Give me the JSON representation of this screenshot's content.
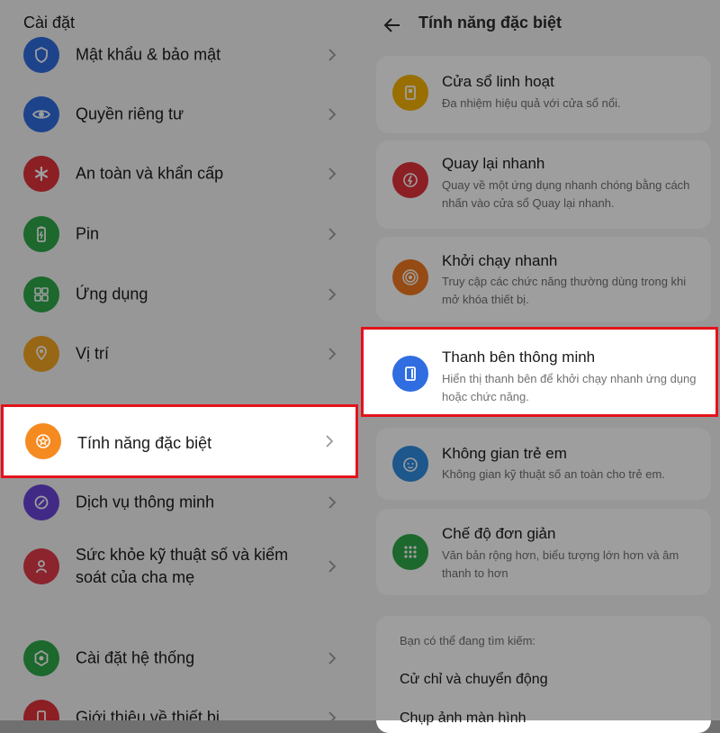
{
  "left": {
    "header": "Cài đặt",
    "items": [
      {
        "label": "Mật khẩu & bảo mật",
        "color": "#2f6de0",
        "icon": "shield-icon"
      },
      {
        "label": "Quyền riêng tư",
        "color": "#2f6de0",
        "icon": "privacy-eye-icon"
      },
      {
        "label": "An toàn và khẩn cấp",
        "color": "#e0323a",
        "icon": "emergency-asterisk-icon"
      },
      {
        "label": "Pin",
        "color": "#2ea94a",
        "icon": "battery-icon"
      },
      {
        "label": "Ứng dụng",
        "color": "#2ea94a",
        "icon": "apps-grid-icon"
      },
      {
        "label": "Vị trí",
        "color": "#f5a623",
        "icon": "location-pin-icon"
      },
      {
        "label": "Tính năng đặc biệt",
        "color": "#f58a20",
        "icon": "special-features-star-icon"
      },
      {
        "label": "Dịch vụ thông minh",
        "color": "#6a45d8",
        "icon": "smart-services-icon"
      },
      {
        "label": "Sức khỏe kỹ thuật số và kiểm soát của cha mẹ",
        "line1": "Sức khỏe kỹ thuật số và kiểm",
        "line2": "soát của cha mẹ",
        "color": "#e03a4a",
        "icon": "digital-wellbeing-icon"
      },
      {
        "label": "Cài đặt hệ thống",
        "color": "#2ea94a",
        "icon": "system-settings-gear-icon"
      },
      {
        "label": "Giới thiệu về thiết bị",
        "color": "#e0323a",
        "icon": "about-device-icon"
      }
    ]
  },
  "right": {
    "header": "Tính năng đặc biệt",
    "cards": [
      {
        "title": "Cửa sổ linh hoạt",
        "desc": "Đa nhiệm hiệu quả với cửa sổ nổi.",
        "color": "#f5b400",
        "icon": "flexible-window-icon"
      },
      {
        "title": "Quay lại nhanh",
        "desc": "Quay về một ứng dụng nhanh chóng bằng cách nhấn vào cửa sổ Quay lại nhanh.",
        "color": "#e0323a",
        "icon": "quick-return-lightning-icon"
      },
      {
        "title": "Khởi chạy nhanh",
        "desc": "Truy cập các chức năng thường dùng trong khi mở khóa thiết bị.",
        "color": "#f07a20",
        "icon": "quick-launch-icon"
      },
      {
        "title": "Thanh bên thông minh",
        "desc": "Hiển thị thanh bên để khởi chạy nhanh ứng dụng hoặc chức năng.",
        "color": "#2f6de0",
        "icon": "smart-sidebar-icon"
      },
      {
        "title": "Không gian trẻ em",
        "desc": "Không gian kỹ thuật số an toàn cho trẻ em.",
        "color": "#2f8de0",
        "icon": "kids-space-icon"
      },
      {
        "title": "Chế độ đơn giản",
        "desc": "Văn bản rộng hơn, biểu tượng lớn hơn và âm thanh to hơn",
        "color": "#2ea94a",
        "icon": "simple-mode-grid-icon"
      }
    ],
    "search": {
      "hint": "Bạn có thể đang tìm kiếm:",
      "suggestions": [
        "Cử chỉ và chuyển động",
        "Chụp ảnh màn hình"
      ]
    }
  }
}
